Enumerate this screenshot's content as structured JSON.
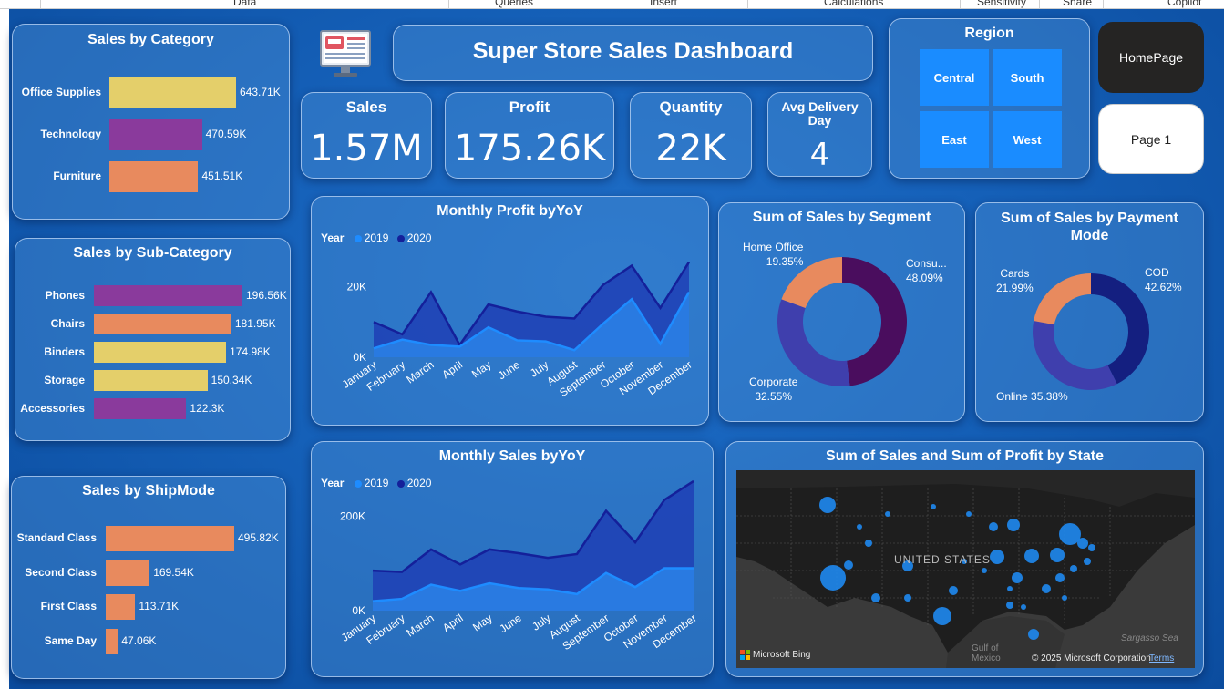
{
  "ribbon": {
    "tabs": [
      "Data",
      "Queries",
      "Insert",
      "Calculations",
      "Sensitivity",
      "Share",
      "Copilot"
    ]
  },
  "header": {
    "title": "Super Store Sales Dashboard"
  },
  "kpis": {
    "sales": {
      "label": "Sales",
      "value": "1.57M"
    },
    "profit": {
      "label": "Profit",
      "value": "175.26K"
    },
    "quantity": {
      "label": "Quantity",
      "value": "22K"
    },
    "delivery": {
      "label": "Avg Delivery Day",
      "value": "4"
    }
  },
  "region": {
    "title": "Region",
    "tiles": [
      "Central",
      "South",
      "East",
      "West"
    ]
  },
  "nav": {
    "homepage": "HomePage",
    "page1": "Page 1"
  },
  "colors": {
    "yellow": "#e4cf6a",
    "purple": "#8a3a9c",
    "orange": "#e88a5e",
    "y2019": "#1e8cff",
    "y2020": "#14209a"
  },
  "category": {
    "title": "Sales by Category",
    "items": [
      {
        "label": "Office Supplies",
        "value": 643.71,
        "text": "643.71K",
        "color": "yellow"
      },
      {
        "label": "Technology",
        "value": 470.59,
        "text": "470.59K",
        "color": "purple"
      },
      {
        "label": "Furniture",
        "value": 451.51,
        "text": "451.51K",
        "color": "orange"
      }
    ]
  },
  "subcategory": {
    "title": "Sales by Sub-Category",
    "items": [
      {
        "label": "Phones",
        "value": 196.56,
        "text": "196.56K",
        "color": "purple"
      },
      {
        "label": "Chairs",
        "value": 181.95,
        "text": "181.95K",
        "color": "orange"
      },
      {
        "label": "Binders",
        "value": 174.98,
        "text": "174.98K",
        "color": "yellow"
      },
      {
        "label": "Storage",
        "value": 150.34,
        "text": "150.34K",
        "color": "yellow"
      },
      {
        "label": "Accessories",
        "value": 122.3,
        "text": "122.3K",
        "color": "purple"
      }
    ]
  },
  "shipmode": {
    "title": "Sales by ShipMode",
    "items": [
      {
        "label": "Standard Class",
        "value": 495.82,
        "text": "495.82K",
        "color": "orange"
      },
      {
        "label": "Second Class",
        "value": 169.54,
        "text": "169.54K",
        "color": "orange"
      },
      {
        "label": "First Class",
        "value": 113.71,
        "text": "113.71K",
        "color": "orange"
      },
      {
        "label": "Same Day",
        "value": 47.06,
        "text": "47.06K",
        "color": "orange"
      }
    ]
  },
  "chart_data": [
    {
      "type": "area",
      "title": "Monthly Profit byYoY",
      "legend_title": "Year",
      "legend_placement": "top-left",
      "categories": [
        "January",
        "February",
        "March",
        "April",
        "May",
        "June",
        "July",
        "August",
        "September",
        "October",
        "November",
        "December"
      ],
      "yticks": [
        "0K",
        "20K"
      ],
      "ylim": [
        0,
        30000
      ],
      "series": [
        {
          "name": "2019",
          "values": [
            2500,
            5000,
            3500,
            3000,
            8500,
            4800,
            4500,
            2000,
            9500,
            16500,
            3800,
            18500
          ]
        },
        {
          "name": "2020",
          "values": [
            10000,
            6500,
            18500,
            3500,
            15000,
            13000,
            11500,
            11000,
            20500,
            26000,
            14000,
            27000
          ]
        }
      ]
    },
    {
      "type": "area",
      "title": "Monthly Sales byYoY",
      "legend_title": "Year",
      "legend_placement": "top-left",
      "categories": [
        "January",
        "February",
        "March",
        "April",
        "May",
        "June",
        "July",
        "August",
        "September",
        "October",
        "November",
        "December"
      ],
      "yticks": [
        "0K",
        "200K"
      ],
      "ylim": [
        0,
        300000
      ],
      "series": [
        {
          "name": "2019",
          "values": [
            20000,
            25000,
            55000,
            42000,
            58000,
            48000,
            45000,
            35000,
            80000,
            50000,
            90000,
            90000
          ]
        },
        {
          "name": "2020",
          "values": [
            85000,
            82000,
            130000,
            98000,
            130000,
            122000,
            112000,
            120000,
            212000,
            145000,
            235000,
            275000
          ]
        }
      ]
    },
    {
      "type": "pie",
      "title": "Sum of Sales by Segment",
      "slices": [
        {
          "label": "Consu...",
          "value": 48.09,
          "text": "48.09%",
          "color": "#4a0d5e"
        },
        {
          "label": "Corporate",
          "value": 32.55,
          "text": "32.55%",
          "color": "#3f3fad"
        },
        {
          "label": "Home Office",
          "value": 19.35,
          "text": "19.35%",
          "color": "#e88a5e"
        }
      ]
    },
    {
      "type": "pie",
      "title": "Sum of Sales by Payment Mode",
      "slices": [
        {
          "label": "COD",
          "value": 42.62,
          "text": "42.62%",
          "color": "#141f80"
        },
        {
          "label": "Online",
          "value": 35.38,
          "text": "35.38%",
          "color": "#3f3fad"
        },
        {
          "label": "Cards",
          "value": 21.99,
          "text": "21.99%",
          "color": "#e88a5e"
        }
      ]
    }
  ],
  "map": {
    "title": "Sum of Sales and Sum of Profit by State",
    "country_label": "UNITED STATES",
    "gulf_label": "Gulf of Mexico",
    "sea_label": "Sargasso Sea",
    "bing": "Microsoft Bing",
    "copyright": "© 2025 Microsoft Corporation",
    "terms": "Terms"
  }
}
